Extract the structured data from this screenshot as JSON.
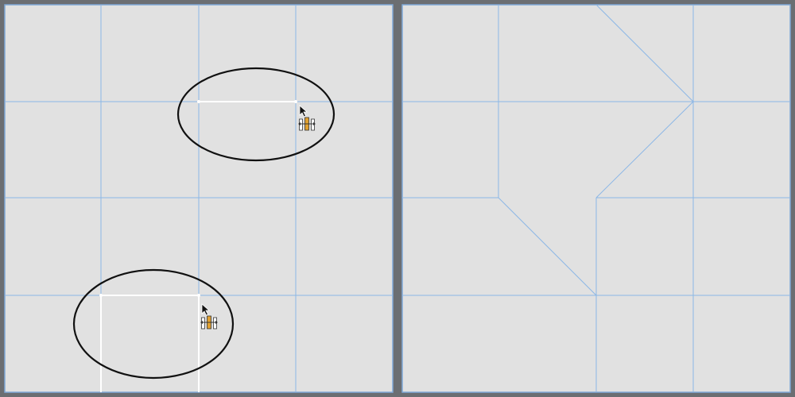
{
  "panels": [
    {
      "id": "left-panel",
      "label": ""
    },
    {
      "id": "right-panel",
      "label": ""
    }
  ],
  "colors": {
    "background": "#6b6e72",
    "panel_fill": "#e1e1e1",
    "panel_border": "#7fa8d8",
    "grid_line": "#8cb7e6",
    "selected_edge": "#ffffff",
    "ellipse_stroke": "#111111",
    "cursor_fill": "#111111",
    "tool_accent": "#e0a030"
  },
  "icons": {
    "cursor": "arrow-pointer-icon",
    "tool": "edge-slide-tool-icon"
  }
}
